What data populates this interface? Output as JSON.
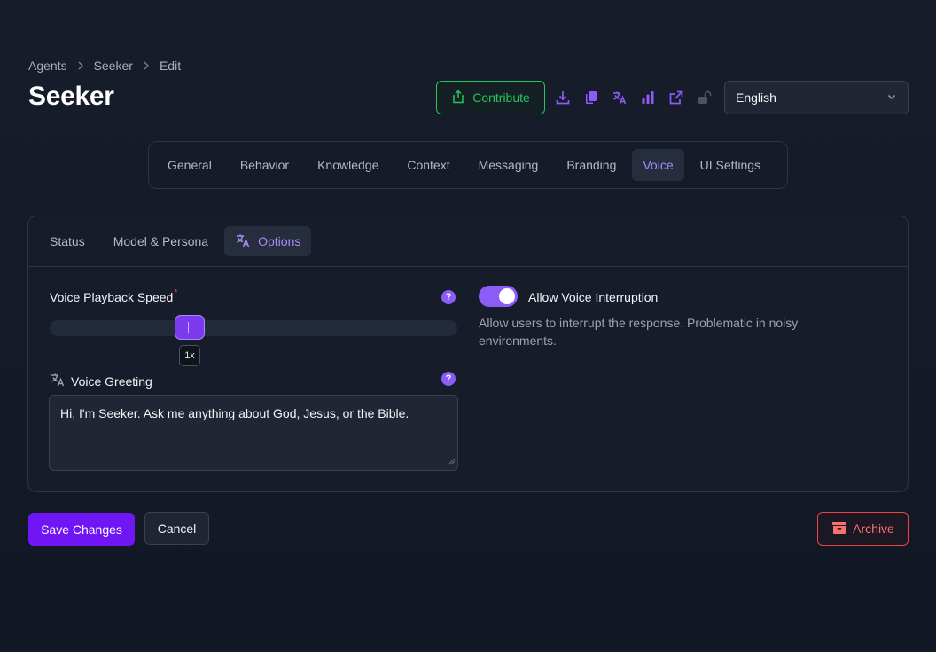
{
  "breadcrumb": [
    "Agents",
    "Seeker",
    "Edit"
  ],
  "title": "Seeker",
  "header": {
    "contribute_label": "Contribute",
    "language": "English",
    "icons": [
      "download-icon",
      "copy-icon",
      "translate-icon",
      "analytics-icon",
      "external-link-icon",
      "unlock-icon"
    ]
  },
  "tabs": [
    "General",
    "Behavior",
    "Knowledge",
    "Context",
    "Messaging",
    "Branding",
    "Voice",
    "UI Settings"
  ],
  "active_tab": "Voice",
  "subtabs": [
    "Status",
    "Model & Persona",
    "Options"
  ],
  "active_subtab": "Options",
  "voice": {
    "playback_speed_label": "Voice Playback Speed",
    "playback_speed_required": "*",
    "playback_speed_value": "1x",
    "playback_speed_fraction": 0.33,
    "greeting_label": "Voice Greeting",
    "greeting_value": "Hi, I'm Seeker. Ask me anything about God, Jesus, or the Bible.",
    "interruption_label": "Allow Voice Interruption",
    "interruption_enabled": true,
    "interruption_description": "Allow users to interrupt the response. Problematic in noisy environments.",
    "help_glyph": "?"
  },
  "actions": {
    "save_label": "Save Changes",
    "cancel_label": "Cancel",
    "archive_label": "Archive"
  },
  "colors": {
    "accent": "#8b5cf6",
    "contribute": "#22c55e",
    "danger": "#ef4444",
    "save": "#7016f5"
  }
}
